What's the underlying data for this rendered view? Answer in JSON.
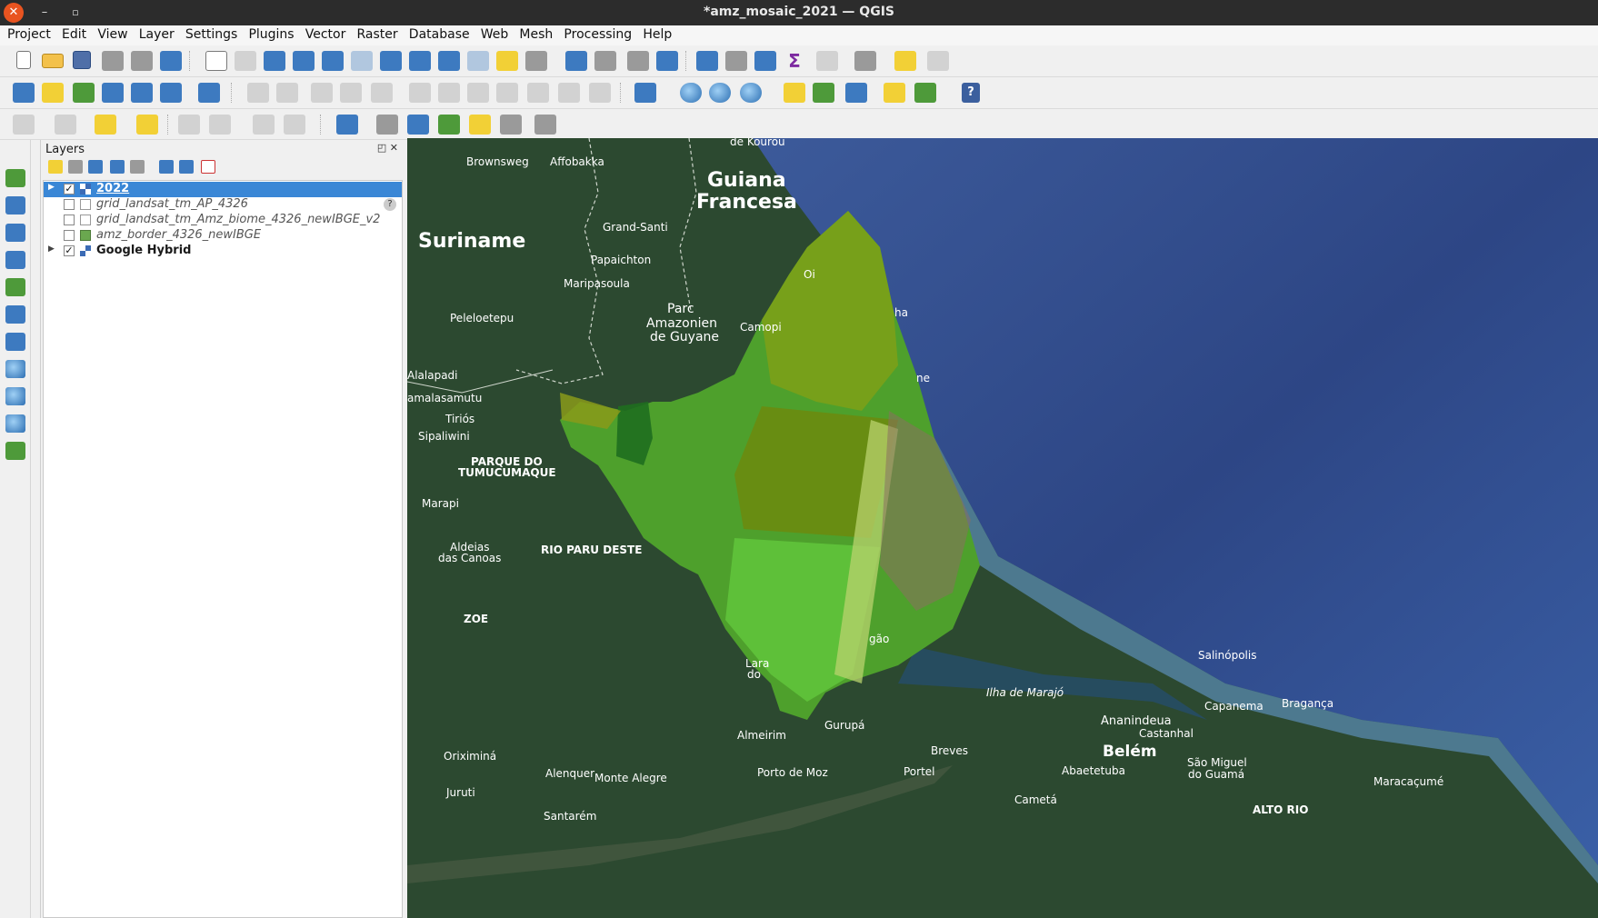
{
  "window": {
    "title": "*amz_mosaic_2021 — QGIS",
    "close_glyph": "✕",
    "min_glyph": "–",
    "max_glyph": "▫"
  },
  "menubar": [
    "Project",
    "Edit",
    "View",
    "Layer",
    "Settings",
    "Plugins",
    "Vector",
    "Raster",
    "Database",
    "Web",
    "Mesh",
    "Processing",
    "Help"
  ],
  "layers_panel": {
    "title": "Layers",
    "float_glyph": "◰",
    "close_glyph": "✕",
    "layers": [
      {
        "name": "2022",
        "checked": true,
        "selected": true,
        "icon": "raster-icon",
        "expandable": true,
        "style": "normal"
      },
      {
        "name": "grid_landsat_tm_AP_4326",
        "checked": false,
        "selected": false,
        "icon": "empty-vector-icon",
        "expandable": false,
        "style": "italic",
        "warning": "?"
      },
      {
        "name": "grid_landsat_tm_Amz_biome_4326_newIBGE_v2",
        "checked": false,
        "selected": false,
        "icon": "empty-vector-icon",
        "expandable": false,
        "style": "italic"
      },
      {
        "name": "amz_border_4326_newIBGE",
        "checked": false,
        "selected": false,
        "icon": "green-polygon-icon",
        "expandable": false,
        "style": "italic"
      },
      {
        "name": "Google Hybrid",
        "checked": true,
        "selected": false,
        "icon": "raster-icon",
        "expandable": true,
        "style": "bold"
      }
    ]
  },
  "map": {
    "labels": {
      "de_kourou": "de Kourou",
      "brownsweg": "Brownsweg",
      "affobakka": "Affobakka",
      "guiana1": "Guiana",
      "guiana2": "Francesa",
      "suriname": "Suriname",
      "grand_santi": "Grand-Santi",
      "papaichton": "Papaichton",
      "maripasoula": "Maripasoula",
      "peleloetepu": "Peleloetepu",
      "parc1": "Parc",
      "parc2": "Amazonien",
      "parc3": "de Guyane",
      "camopi": "Camopi",
      "alalapadi": "Alalapadi",
      "amalasamutu": "amalasamutu",
      "tirios": "Tiriós",
      "sipaliwini": "Sipaliwini",
      "parque1": "PARQUE DO",
      "parque2": "TUMUCUMAQUE",
      "marapi": "Marapi",
      "aldeias1": "Aldeias",
      "aldeias2": "das Canoas",
      "rio_paru": "RIO PARU DESTE",
      "zoe": "ZOE",
      "oi": "Oi",
      "ha": "ha",
      "ne": "ne",
      "lara1": "Lara",
      "lara2": "do",
      "gao": "gão",
      "salinopolis": "Salinópolis",
      "ilha": "Ilha de Marajó",
      "capanema": "Capanema",
      "braganca": "Bragança",
      "ananindeua": "Ananindeua",
      "castanhal": "Castanhal",
      "belem": "Belém",
      "sao_miguel1": "São Miguel",
      "sao_miguel2": "do Guamá",
      "gurupa": "Gurupá",
      "almeirim": "Almeirim",
      "breves": "Breves",
      "oriximina": "Oriximiná",
      "alenquer": "Alenquer",
      "monte_alegre": "Monte Alegre",
      "porto_de_moz": "Porto de Moz",
      "portel": "Portel",
      "abaetetuba": "Abaetetuba",
      "maracacume": "Maracaçumé",
      "juruti": "Juruti",
      "cameta": "Cametá",
      "santarem": "Santarém",
      "alto_rio": "ALTO RIO"
    }
  }
}
